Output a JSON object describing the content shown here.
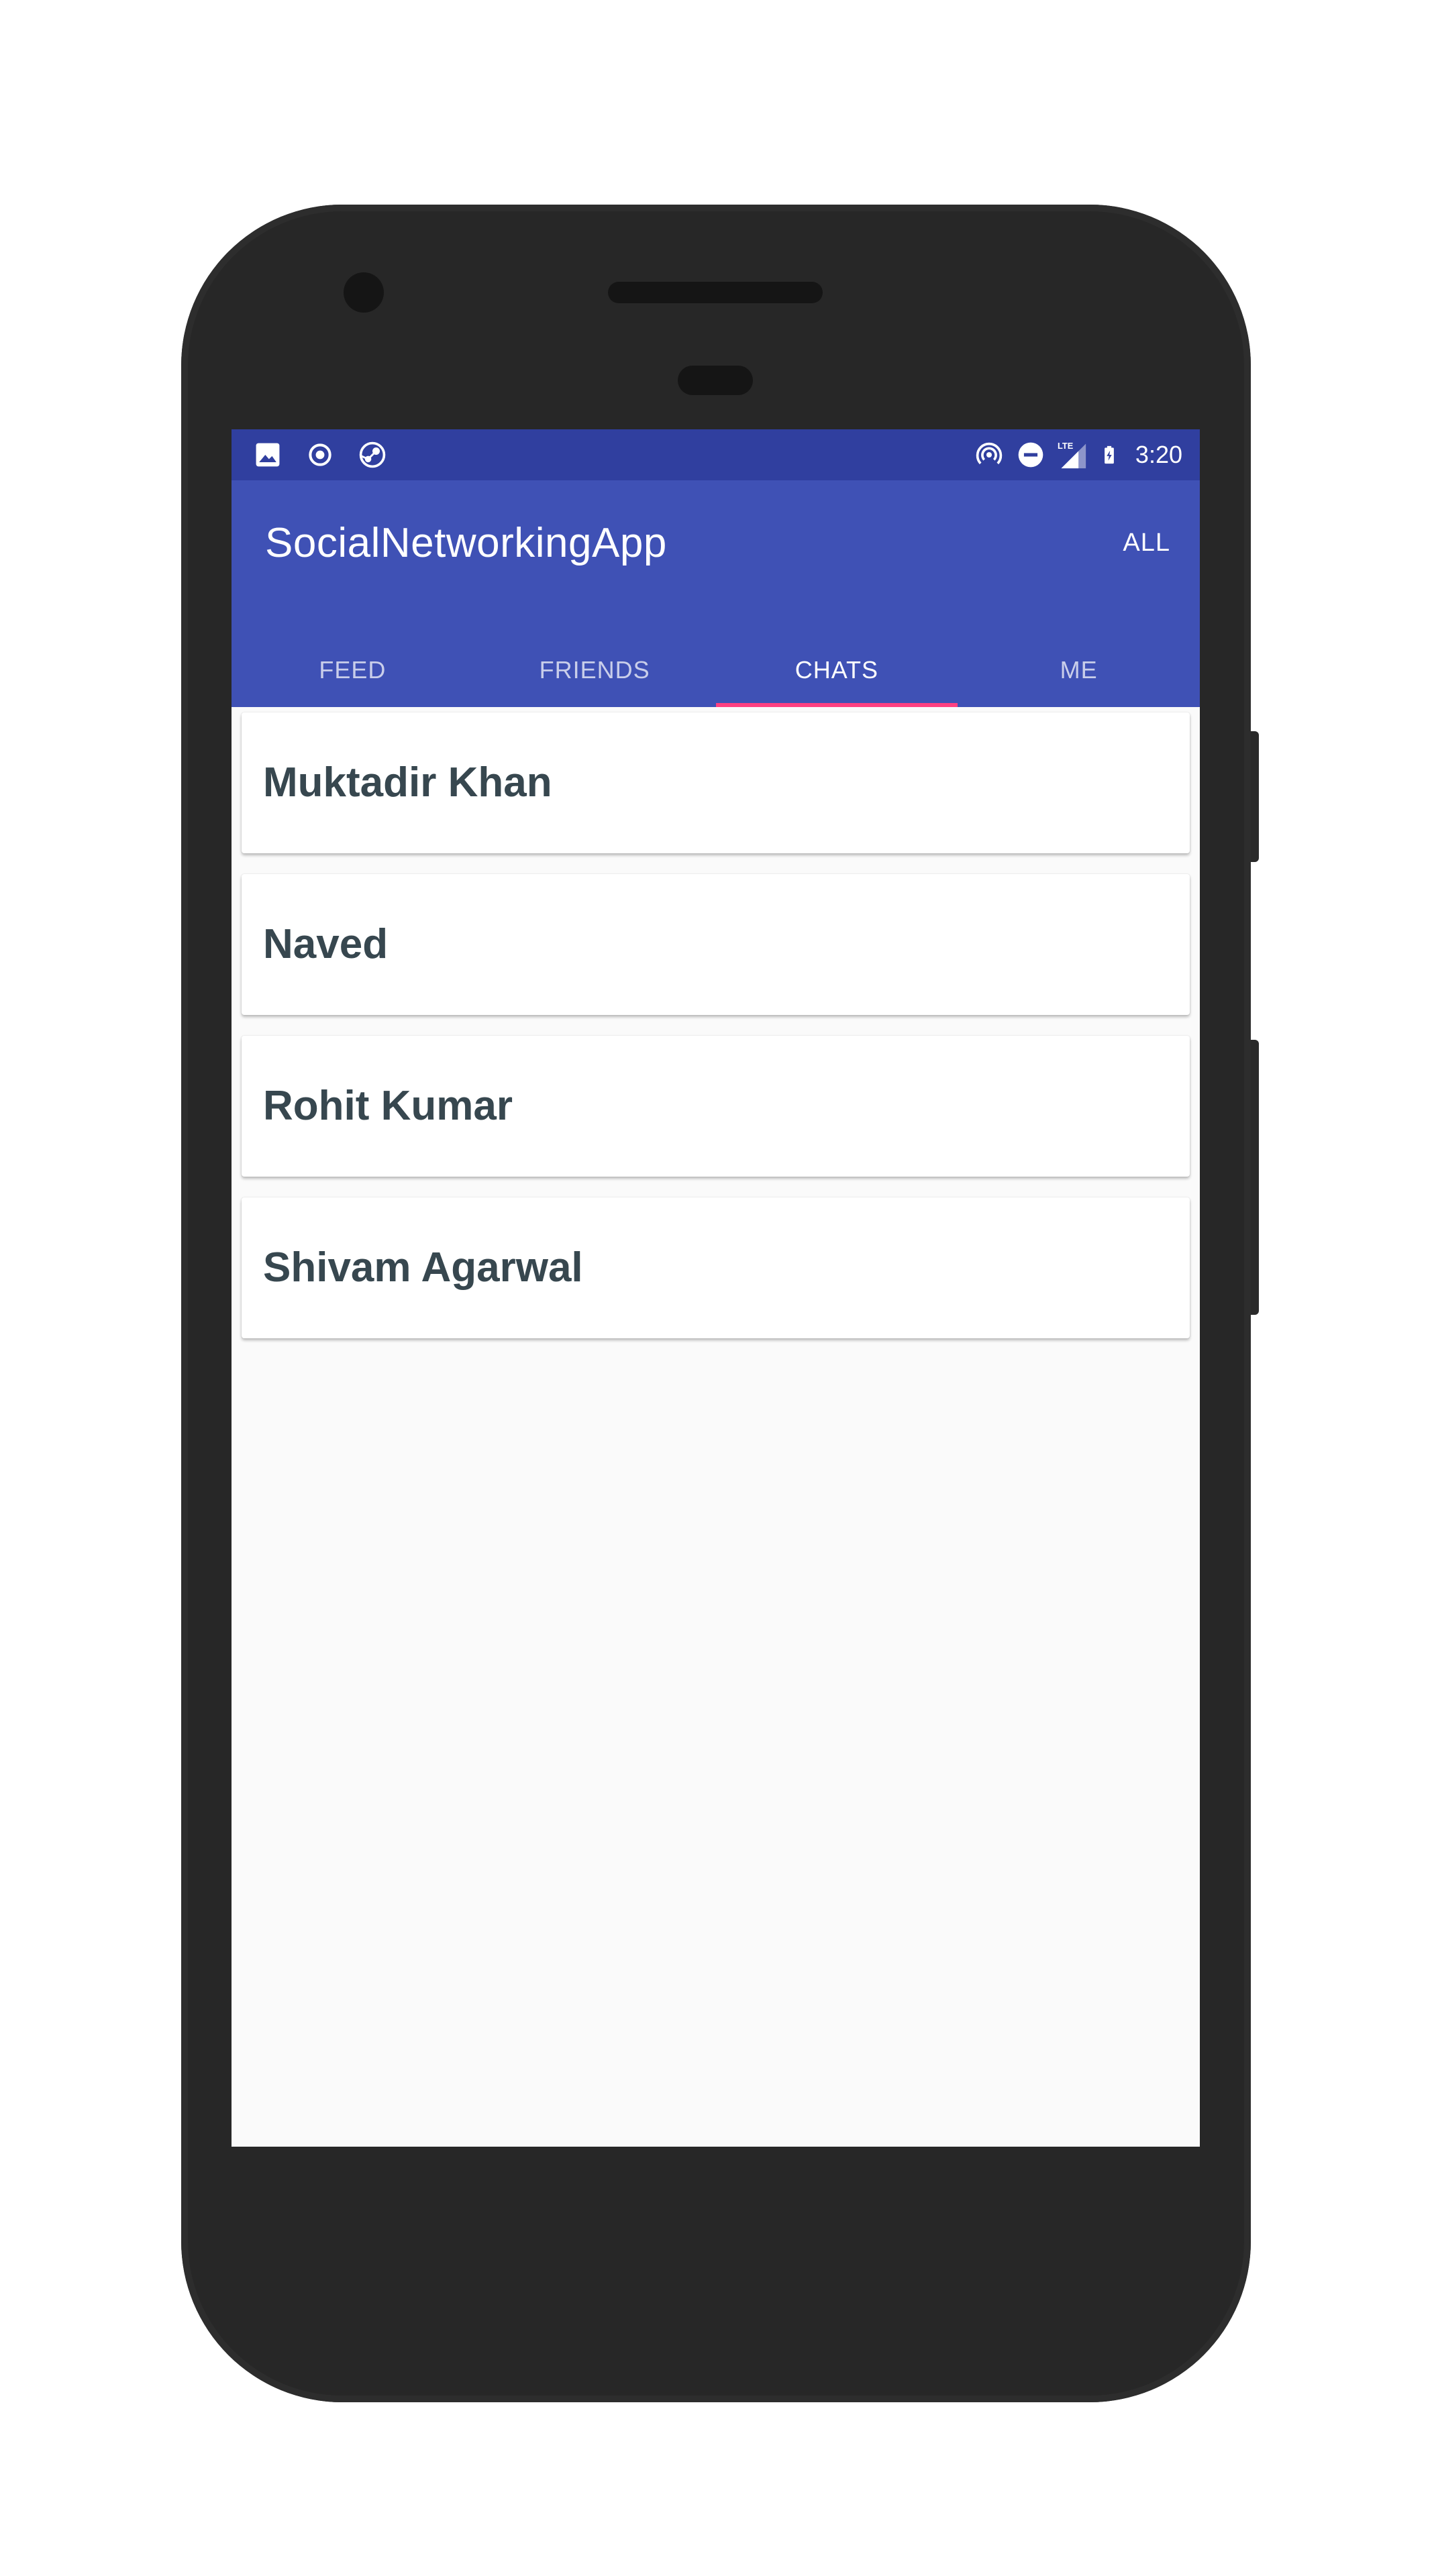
{
  "status_bar": {
    "left_icons": [
      "image-icon",
      "record-icon",
      "steam-icon"
    ],
    "right_icons": [
      "hotspot-icon",
      "do-not-disturb-icon",
      "lte-signal-icon",
      "battery-charging-icon"
    ],
    "network_label": "LTE",
    "time": "3:20"
  },
  "app_bar": {
    "title": "SocialNetworkingApp",
    "action": "ALL"
  },
  "tabs": [
    {
      "label": "FEED",
      "active": false
    },
    {
      "label": "FRIENDS",
      "active": false
    },
    {
      "label": "CHATS",
      "active": true
    },
    {
      "label": "ME",
      "active": false
    }
  ],
  "chats": [
    {
      "name": "Muktadir Khan"
    },
    {
      "name": "Naved"
    },
    {
      "name": "Rohit Kumar"
    },
    {
      "name": "Shivam Agarwal"
    }
  ],
  "colors": {
    "status_bar": "#303f9f",
    "primary": "#3f51b5",
    "accent": "#ff4081",
    "name_text": "#37474f",
    "background": "#fafafa",
    "device_frame": "#272727"
  }
}
